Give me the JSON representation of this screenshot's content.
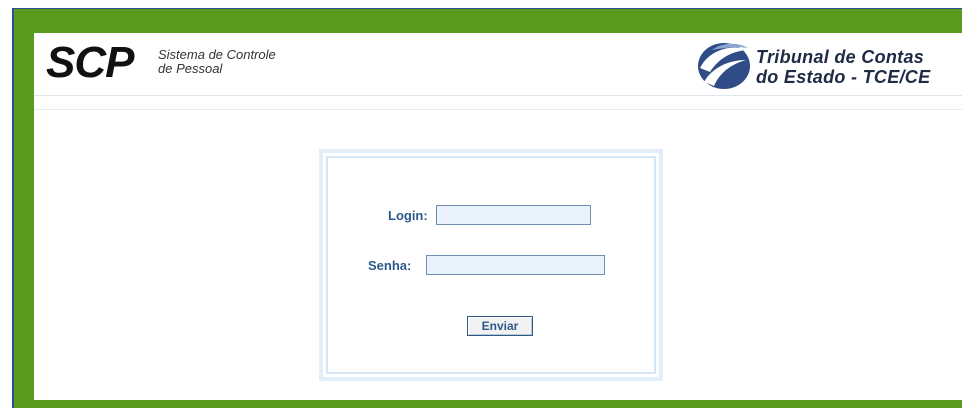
{
  "header": {
    "brand_short": "SCP",
    "brand_sub_line1": "Sistema de Controle",
    "brand_sub_line2": "de Pessoal",
    "org_line1": "Tribunal de Contas",
    "org_line2": "do Estado - TCE/CE",
    "org_logo_icon": "tce-swoosh-logo"
  },
  "login": {
    "login_label": "Login:",
    "login_value": "",
    "password_label": "Senha:",
    "password_value": "",
    "submit_label": "Enviar"
  },
  "colors": {
    "frame_green": "#5a9a1c",
    "frame_border_blue": "#2f4f9a",
    "label_blue": "#2e5a8a",
    "input_background": "#eaf3fc",
    "box_border": "#d6e6f5"
  }
}
